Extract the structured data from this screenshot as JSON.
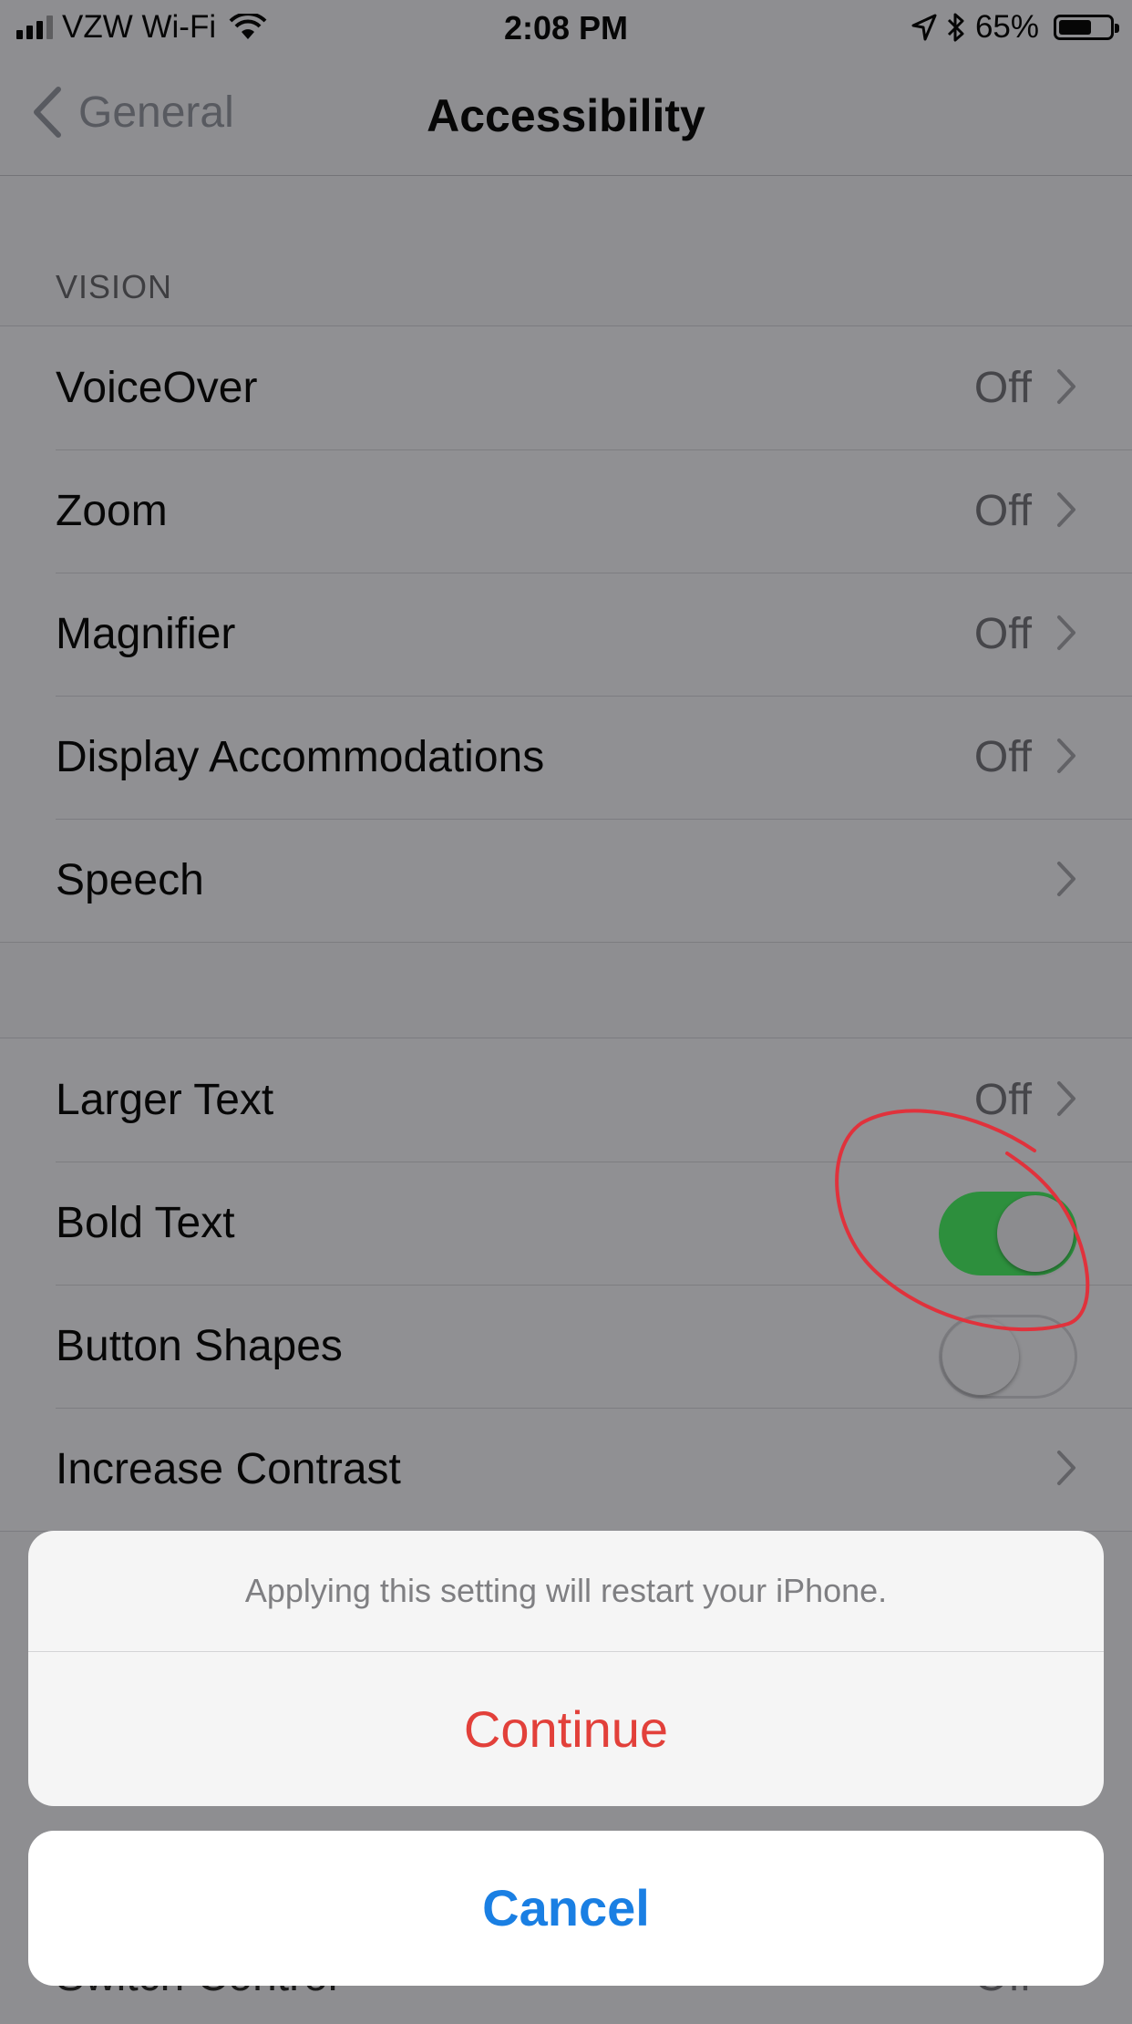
{
  "status_bar": {
    "carrier": "VZW Wi-Fi",
    "time": "2:08 PM",
    "battery": "65%",
    "battery_level": 0.65,
    "icons": [
      "signal-icon",
      "wifi-icon",
      "location-icon",
      "bluetooth-icon",
      "battery-icon"
    ]
  },
  "nav": {
    "back_label": "General",
    "title": "Accessibility"
  },
  "vision_section": {
    "header": "VISION",
    "rows": [
      {
        "label": "VoiceOver",
        "value": "Off"
      },
      {
        "label": "Zoom",
        "value": "Off"
      },
      {
        "label": "Magnifier",
        "value": "Off"
      },
      {
        "label": "Display Accommodations",
        "value": "Off"
      },
      {
        "label": "Speech",
        "value": ""
      }
    ]
  },
  "text_section": {
    "rows": [
      {
        "label": "Larger Text",
        "value": "Off"
      },
      {
        "label": "Bold Text",
        "toggle": true
      },
      {
        "label": "Button Shapes",
        "toggle": false
      },
      {
        "label": "Increase Contrast",
        "value": ""
      }
    ]
  },
  "hidden_row": {
    "label": "Switch Control",
    "value": "Off"
  },
  "action_sheet": {
    "message": "Applying this setting will restart your iPhone.",
    "continue_label": "Continue",
    "cancel_label": "Cancel"
  },
  "colors": {
    "toggle_on": "#2d8f3d",
    "destructive": "#e2403a",
    "link_blue": "#1a7fe3",
    "annotation_red": "#e0323c"
  }
}
